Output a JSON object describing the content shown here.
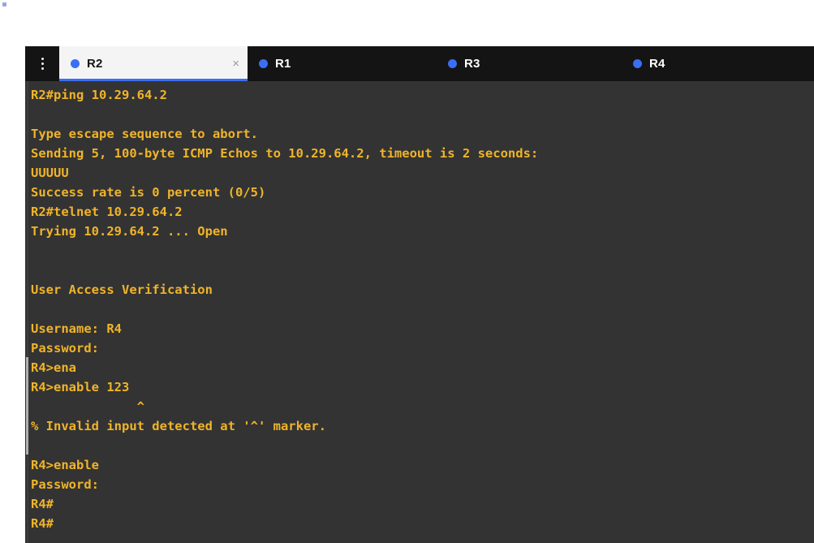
{
  "window": {
    "background_color": "#ffffff",
    "terminal_bg": "#333333",
    "tabbar_bg": "#141414",
    "text_color": "#f0b429",
    "accent_color": "#3b6ef5"
  },
  "tabbar": {
    "menu_button": {
      "name": "overflow-menu",
      "icon": "kebab-menu-icon"
    },
    "tabs": [
      {
        "label": "R2",
        "active": true,
        "status_icon": "blue-dot-icon",
        "close_icon": "×",
        "closable": true
      },
      {
        "label": "R1",
        "active": false,
        "status_icon": "blue-dot-icon",
        "closable": false
      },
      {
        "label": "R3",
        "active": false,
        "status_icon": "blue-dot-icon",
        "closable": false
      },
      {
        "label": "R4",
        "active": false,
        "status_icon": "blue-dot-icon",
        "closable": false
      }
    ]
  },
  "console": {
    "lines": [
      "R2#ping 10.29.64.2",
      "",
      "Type escape sequence to abort.",
      "Sending 5, 100-byte ICMP Echos to 10.29.64.2, timeout is 2 seconds:",
      "UUUUU",
      "Success rate is 0 percent (0/5)",
      "R2#telnet 10.29.64.2",
      "Trying 10.29.64.2 ... Open",
      "",
      "",
      "User Access Verification",
      "",
      "Username: R4",
      "Password:",
      "R4>ena",
      "R4>enable 123",
      "              ^",
      "% Invalid input detected at '^' marker.",
      "",
      "R4>enable",
      "Password:",
      "R4#",
      "R4#"
    ],
    "text": "R2#ping 10.29.64.2\n\nType escape sequence to abort.\nSending 5, 100-byte ICMP Echos to 10.29.64.2, timeout is 2 seconds:\nUUUUU\nSuccess rate is 0 percent (0/5)\nR2#telnet 10.29.64.2\nTrying 10.29.64.2 ... Open\n\n\nUser Access Verification\n\nUsername: R4\nPassword:\nR4>ena\nR4>enable 123\n              ^\n% Invalid input detected at '^' marker.\n\nR4>enable\nPassword:\nR4#\nR4#"
  }
}
